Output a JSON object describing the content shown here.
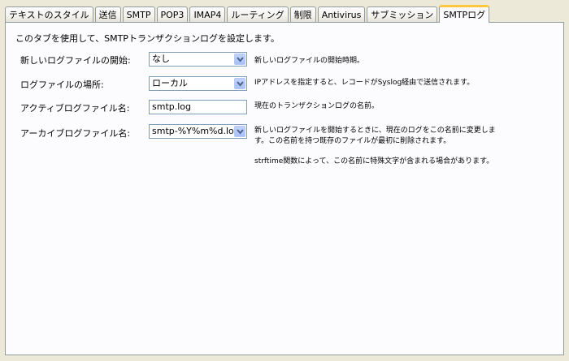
{
  "tabs": [
    {
      "label": "テキストのスタイル",
      "active": false
    },
    {
      "label": "送信",
      "active": false
    },
    {
      "label": "SMTP",
      "active": false
    },
    {
      "label": "POP3",
      "active": false
    },
    {
      "label": "IMAP4",
      "active": false
    },
    {
      "label": "ルーティング",
      "active": false
    },
    {
      "label": "制限",
      "active": false
    },
    {
      "label": "Antivirus",
      "active": false
    },
    {
      "label": "サブミッション",
      "active": false
    },
    {
      "label": "SMTPログ",
      "active": true
    }
  ],
  "panel": {
    "intro": "このタブを使用して、SMTPトランザクションログを設定します。",
    "rows": {
      "new_log_start": {
        "label": "新しいログファイルの開始:",
        "value": "なし",
        "description": "新しいログファイルの開始時期。"
      },
      "log_location": {
        "label": "ログファイルの場所:",
        "value": "ローカル",
        "description": "IPアドレスを指定すると、レコードがSyslog経由で送信されます。"
      },
      "active_log_name": {
        "label": "アクティブログファイル名:",
        "value": "smtp.log",
        "description": "現在のトランザクションログの名前。"
      },
      "archive_log_name": {
        "label": "アーカイブログファイル名:",
        "value": "smtp-%Y%m%d.log",
        "description": "新しいログファイルを開始するときに、現在のログをこの名前に変更します。この名前を持つ既存のファイルが最初に削除されます。",
        "note": "strftime関数によって、この名前に特殊文字が含まれる場合があります。"
      }
    }
  },
  "icons": {
    "dropdown": "chevron-down-icon"
  }
}
